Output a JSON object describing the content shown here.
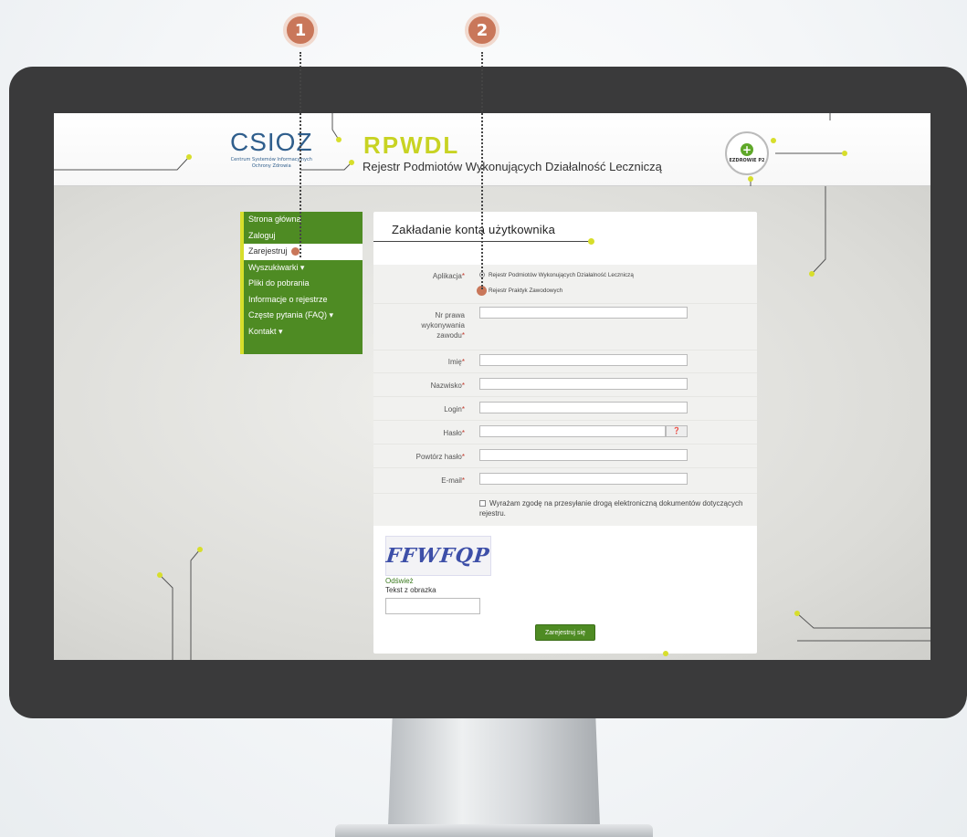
{
  "markers": [
    "1",
    "2"
  ],
  "header": {
    "csioz_logo": "CSIOZ",
    "csioz_sub_1": "Centrum Systemów Informacyjnych",
    "csioz_sub_2": "Ochrony Zdrowia",
    "title": "RPWDL",
    "subtitle": "Rejestr Podmiotów Wykonujących Działalność Leczniczą",
    "ezdrowie_text": "EZDROWIE P2"
  },
  "sidebar": {
    "items": [
      {
        "label": "Strona główna"
      },
      {
        "label": "Zaloguj"
      },
      {
        "label": "Zarejestruj"
      },
      {
        "label": "Wyszukiwarki ▾"
      },
      {
        "label": "Pliki do pobrania"
      },
      {
        "label": "Informacje o rejestrze"
      },
      {
        "label": "Częste pytania (FAQ) ▾"
      },
      {
        "label": "Kontakt ▾"
      }
    ]
  },
  "form": {
    "title": "Zakładanie konta użytkownika",
    "application_label": "Aplikacja",
    "radio_options": [
      "Rejestr Podmiotów Wykonujących Działalność Leczniczą",
      "Rejestr Praktyk Zawodowych"
    ],
    "license_label": "Nr prawa wykonywania zawodu",
    "first_name_label": "Imię",
    "last_name_label": "Nazwisko",
    "login_label": "Login",
    "password_label": "Hasło",
    "password_help": "❓",
    "repeat_password_label": "Powtórz hasło",
    "email_label": "E-mail",
    "required_mark": "*",
    "consent_text": "Wyrażam zgodę na przesyłanie drogą elektroniczną dokumentów dotyczących rejestru.",
    "captcha_text": "FFWFQP",
    "refresh_label": "Odśwież",
    "captcha_label": "Tekst z obrazka",
    "submit_label": "Zarejestruj się"
  },
  "colors": {
    "accent_green": "#4e8b23",
    "accent_yellow": "#d7de2b",
    "marker": "#c9775a",
    "bezel": "#3a3a3b"
  }
}
